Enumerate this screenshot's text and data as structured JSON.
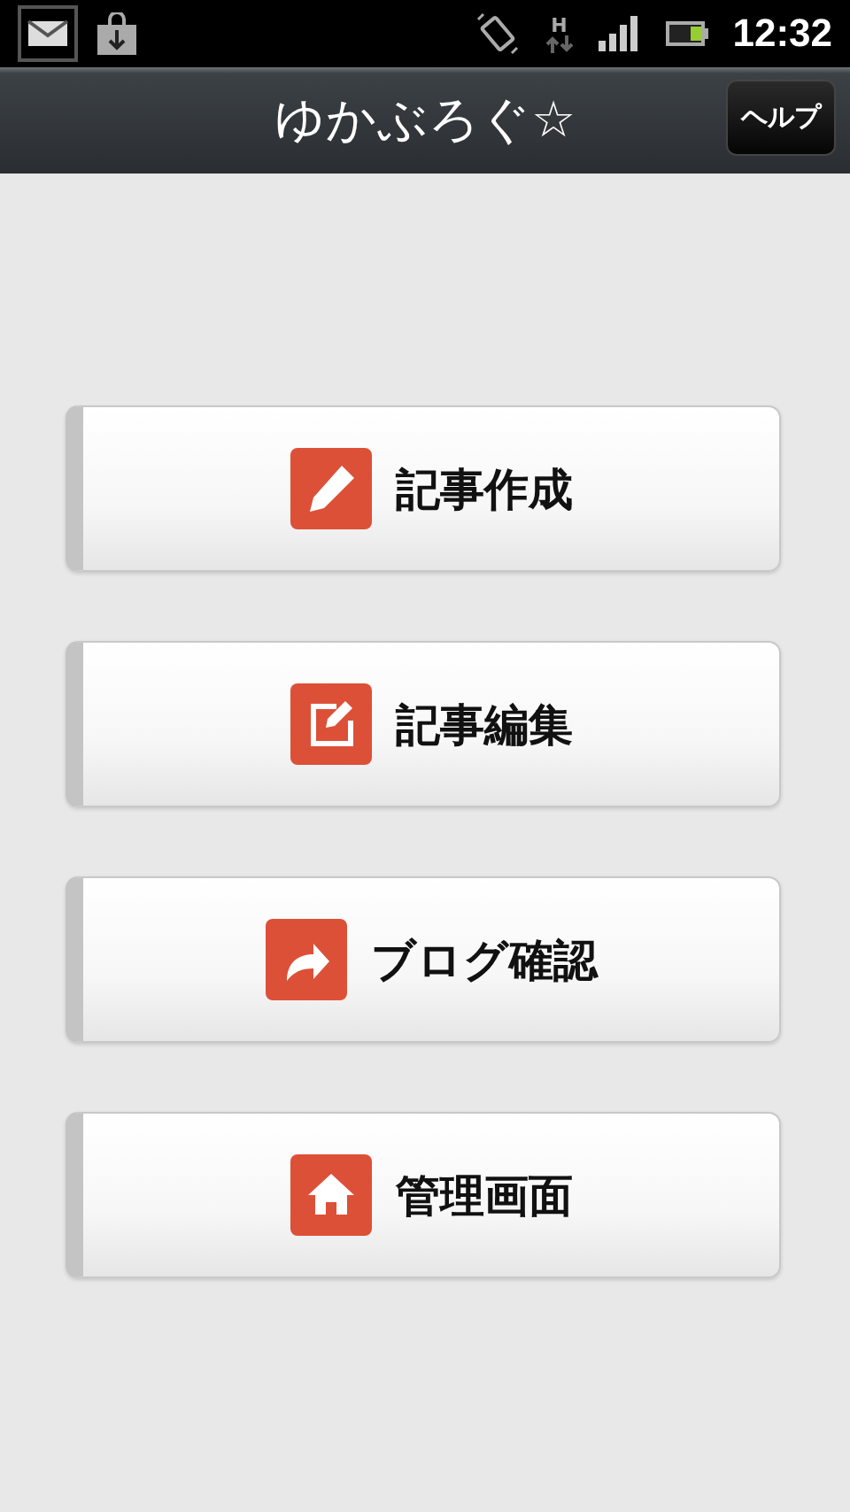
{
  "status_bar": {
    "network_type": "H",
    "time": "12:32"
  },
  "title_bar": {
    "title": "ゆかぶろぐ☆",
    "help_button": "ヘルプ"
  },
  "menu": [
    {
      "label": "記事作成",
      "kind": "pencil"
    },
    {
      "label": "記事編集",
      "kind": "edit"
    },
    {
      "label": "ブログ確認",
      "kind": "share"
    },
    {
      "label": "管理画面",
      "kind": "home"
    }
  ]
}
